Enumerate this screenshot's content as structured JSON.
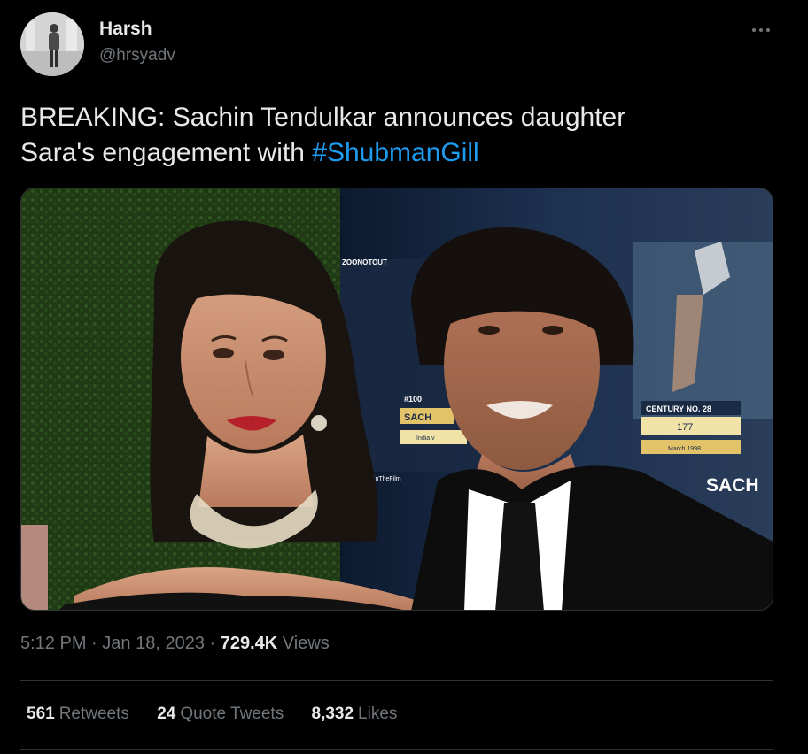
{
  "author": {
    "display_name": "Harsh",
    "handle": "@hrsyadv"
  },
  "tweet": {
    "text_line1": "BREAKING: Sachin Tendulkar announces daughter",
    "text_line2_prefix": "Sara's engagement with ",
    "hashtag": "#ShubmanGill"
  },
  "media": {
    "overlay_texts": {
      "top_logo": "ZOONOTOUT",
      "hundred": "#100",
      "sach_small": "SACH",
      "india": "India v",
      "film_tag": "/SachinTheFilm",
      "century": "CENTURY NO. 28",
      "score": "177",
      "month": "March 1998",
      "sach_large": "SACH"
    }
  },
  "meta": {
    "time": "5:12 PM",
    "separator": "·",
    "date": "Jan 18, 2023",
    "views_count": "729.4K",
    "views_label": "Views"
  },
  "stats": {
    "retweets_count": "561",
    "retweets_label": "Retweets",
    "quotes_count": "24",
    "quotes_label": "Quote Tweets",
    "likes_count": "8,332",
    "likes_label": "Likes"
  },
  "icons": {
    "more": "more-horizontal-icon"
  },
  "colors": {
    "background": "#000000",
    "text_primary": "#e7e9ea",
    "text_secondary": "#71767b",
    "link": "#1d9bf0",
    "divider": "#2f3336"
  }
}
